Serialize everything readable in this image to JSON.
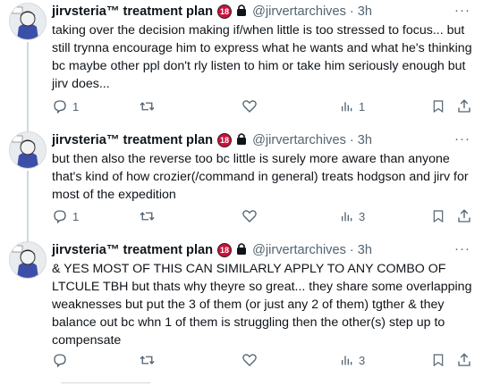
{
  "tweets": [
    {
      "display_name": "jirvsteria™ treatment plan",
      "age_badge": "18",
      "handle": "@jirvertarchives",
      "separator": "·",
      "time": "3h",
      "more": "···",
      "text": "taking over the decision making if/when little is too stressed to focus... but still trynna encourage him to express what he wants and what he's thinking bc maybe other ppl don't rly listen to him or take him seriously enough but jirv does...",
      "reply_count": "1",
      "retweet_count": "",
      "like_count": "",
      "view_count": "1"
    },
    {
      "display_name": "jirvsteria™ treatment plan",
      "age_badge": "18",
      "handle": "@jirvertarchives",
      "separator": "·",
      "time": "3h",
      "more": "···",
      "text": "but then also the reverse too bc little is surely more aware than anyone that's kind of how crozier(/command in general) treats hodgson and jirv for most of the expedition",
      "reply_count": "1",
      "retweet_count": "",
      "like_count": "",
      "view_count": "3"
    },
    {
      "display_name": "jirvsteria™ treatment plan",
      "age_badge": "18",
      "handle": "@jirvertarchives",
      "separator": "·",
      "time": "3h",
      "more": "···",
      "text": "& YES MOST OF THIS CAN SIMILARLY APPLY TO ANY COMBO OF LTCULE TBH but thats why theyre so great... they share some overlapping weaknesses but put the 3 of them (or just any 2 of them) tgther & they balance out bc whn 1 of them is struggling then the other(s) step up to compensate",
      "reply_count": "",
      "retweet_count": "",
      "like_count": "",
      "view_count": "3"
    }
  ],
  "icons": {
    "reply": "reply-icon",
    "retweet": "retweet-icon",
    "like": "heart-icon",
    "views": "views-icon",
    "bookmark": "bookmark-icon",
    "share": "share-icon",
    "lock": "lock-icon",
    "more": "more-icon"
  },
  "colors": {
    "text": "#0f1419",
    "secondary": "#536471",
    "badge": "#d0103a",
    "thread_line": "#cfd9de"
  }
}
